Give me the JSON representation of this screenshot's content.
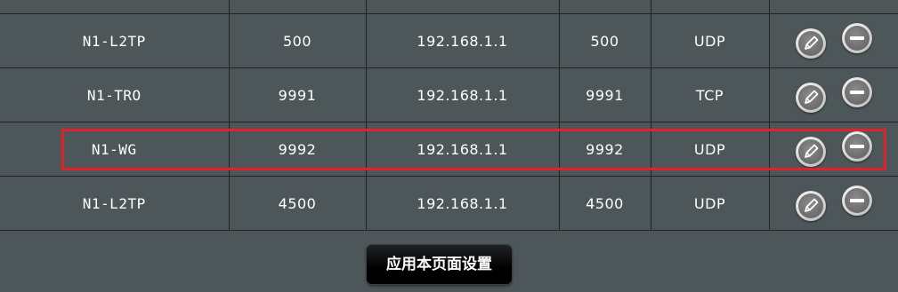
{
  "rows": [
    {
      "service": "",
      "port_range": "",
      "local_ip": "",
      "local_port": "",
      "protocol": ""
    },
    {
      "service": "N1-L2TP",
      "port_range": "500",
      "local_ip": "192.168.1.1",
      "local_port": "500",
      "protocol": "UDP"
    },
    {
      "service": "N1-TRO",
      "port_range": "9991",
      "local_ip": "192.168.1.1",
      "local_port": "9991",
      "protocol": "TCP"
    },
    {
      "service": "N1-WG",
      "port_range": "9992",
      "local_ip": "192.168.1.1",
      "local_port": "9992",
      "protocol": "UDP"
    },
    {
      "service": "N1-L2TP",
      "port_range": "4500",
      "local_ip": "192.168.1.1",
      "local_port": "4500",
      "protocol": "UDP"
    }
  ],
  "icons": {
    "edit": "pencil-icon",
    "delete": "minus-circle-icon"
  },
  "highlight": {
    "color": "#e0232b",
    "row_index": 3
  },
  "apply_button": {
    "label": "应用本页面设置"
  },
  "colors": {
    "background": "#4d5659",
    "grid": "#1f2427",
    "text": "#ffffff"
  }
}
